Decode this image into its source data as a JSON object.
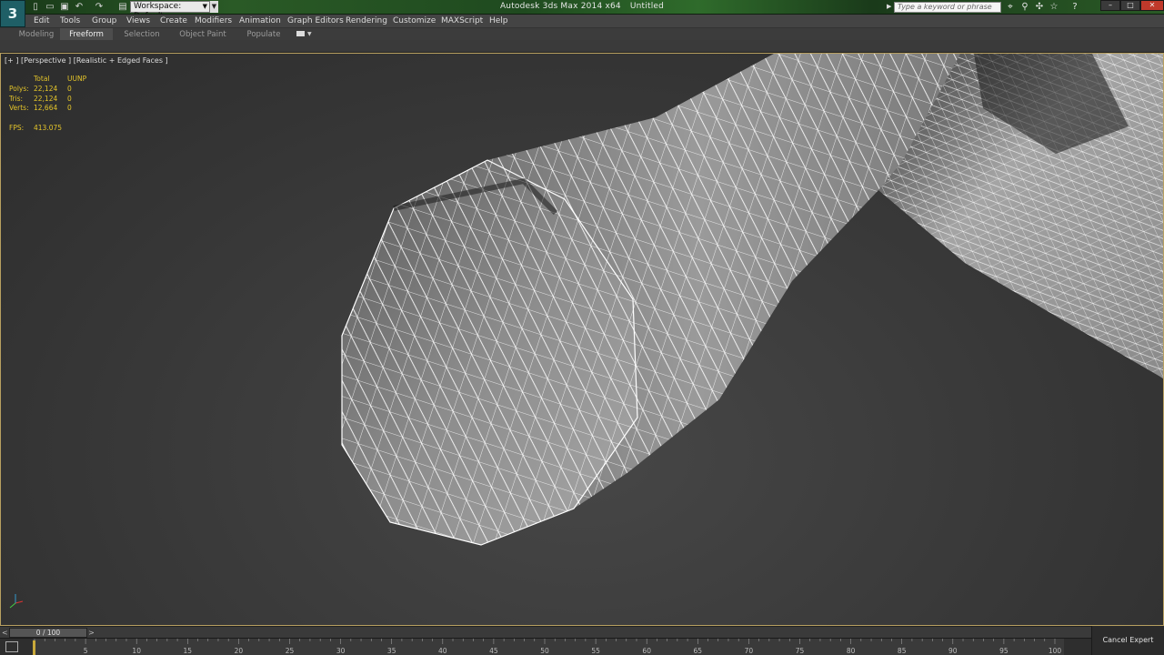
{
  "titlebar": {
    "workspace_label": "Workspace: Default",
    "app_name": "Autodesk 3ds Max  2014 x64",
    "document": "Untitled",
    "search_placeholder": "Type a keyword or phrase"
  },
  "menu": [
    "Edit",
    "Tools",
    "Group",
    "Views",
    "Create",
    "Modifiers",
    "Animation",
    "Graph Editors",
    "Rendering",
    "Customize",
    "MAXScript",
    "Help"
  ],
  "ribbon": {
    "tabs": [
      "Modeling",
      "Freeform",
      "Selection",
      "Object Paint",
      "Populate"
    ],
    "active_tab": "Freeform"
  },
  "viewport": {
    "label": "[+ ] [Perspective ] [Realistic + Edged Faces ]",
    "stats": {
      "header_total": "Total",
      "header_sel": "UUNP",
      "rows": [
        {
          "label": "Polys:",
          "total": "22,124",
          "sel": "0"
        },
        {
          "label": "Tris:",
          "total": "22,124",
          "sel": "0"
        },
        {
          "label": "Verts:",
          "total": "12,664",
          "sel": "0"
        }
      ],
      "fps_label": "FPS:",
      "fps_value": "413.075"
    },
    "colors": {
      "stats": "#e3c42a",
      "border": "#b8a060",
      "wire": "#ffffff"
    }
  },
  "timeline": {
    "slider_label": "0 / 100",
    "ticks": [
      "0",
      "5",
      "10",
      "15",
      "20",
      "25",
      "30",
      "35",
      "40",
      "45",
      "50",
      "55",
      "60",
      "65",
      "70",
      "75",
      "80",
      "85",
      "90",
      "95",
      "100"
    ]
  },
  "status": {
    "expert_button": "Cancel Expert Mode"
  },
  "icons": [
    "3ds-max-logo-icon",
    "new-file-icon",
    "open-file-icon",
    "save-icon",
    "undo-icon",
    "redo-icon",
    "project-folder-icon",
    "binoculars-icon",
    "star-icon",
    "help-icon"
  ]
}
